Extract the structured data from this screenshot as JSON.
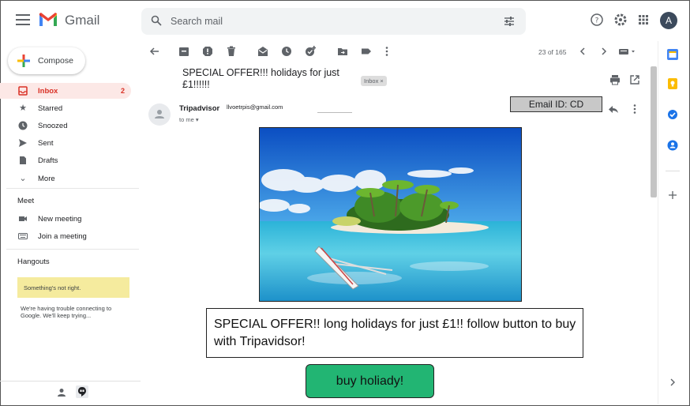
{
  "header": {
    "app_name": "Gmail",
    "search_placeholder": "Search mail",
    "account_initial": "A"
  },
  "sidebar": {
    "compose_label": "Compose",
    "items": [
      {
        "label": "Inbox",
        "count": "2",
        "icon": "inbox-icon"
      },
      {
        "label": "Starred",
        "icon": "star-icon"
      },
      {
        "label": "Snoozed",
        "icon": "clock-icon"
      },
      {
        "label": "Sent",
        "icon": "send-icon"
      },
      {
        "label": "Drafts",
        "icon": "draft-icon"
      },
      {
        "label": "More",
        "icon": "chevron-down-icon"
      }
    ],
    "meet": {
      "title": "Meet",
      "new_meeting": "New meeting",
      "join_meeting": "Join a meeting"
    },
    "hangouts": {
      "title": "Hangouts",
      "warning": "Something's not right.",
      "message": "We're having trouble connecting to Google. We'll keep trying..."
    }
  },
  "toolbar": {
    "pager": "23 of 165"
  },
  "email": {
    "subject": "SPECIAL OFFER!!! holidays for just £1!!!!!!",
    "label_chip": "Inbox ×",
    "sender_name": "Tripadvisor",
    "sender_email": "llvoetrpis@gmail.com",
    "to_line": "to me ▾",
    "email_id": "Email ID: CD",
    "body_text": "SPECIAL OFFER!! long holidays for just £1!! follow button to buy with Tripavidsor!",
    "cta_label": "buy holiady!"
  },
  "colors": {
    "accent_red": "#d93025",
    "cta_green": "#22b573",
    "warning_yellow": "#f5eb9e"
  }
}
